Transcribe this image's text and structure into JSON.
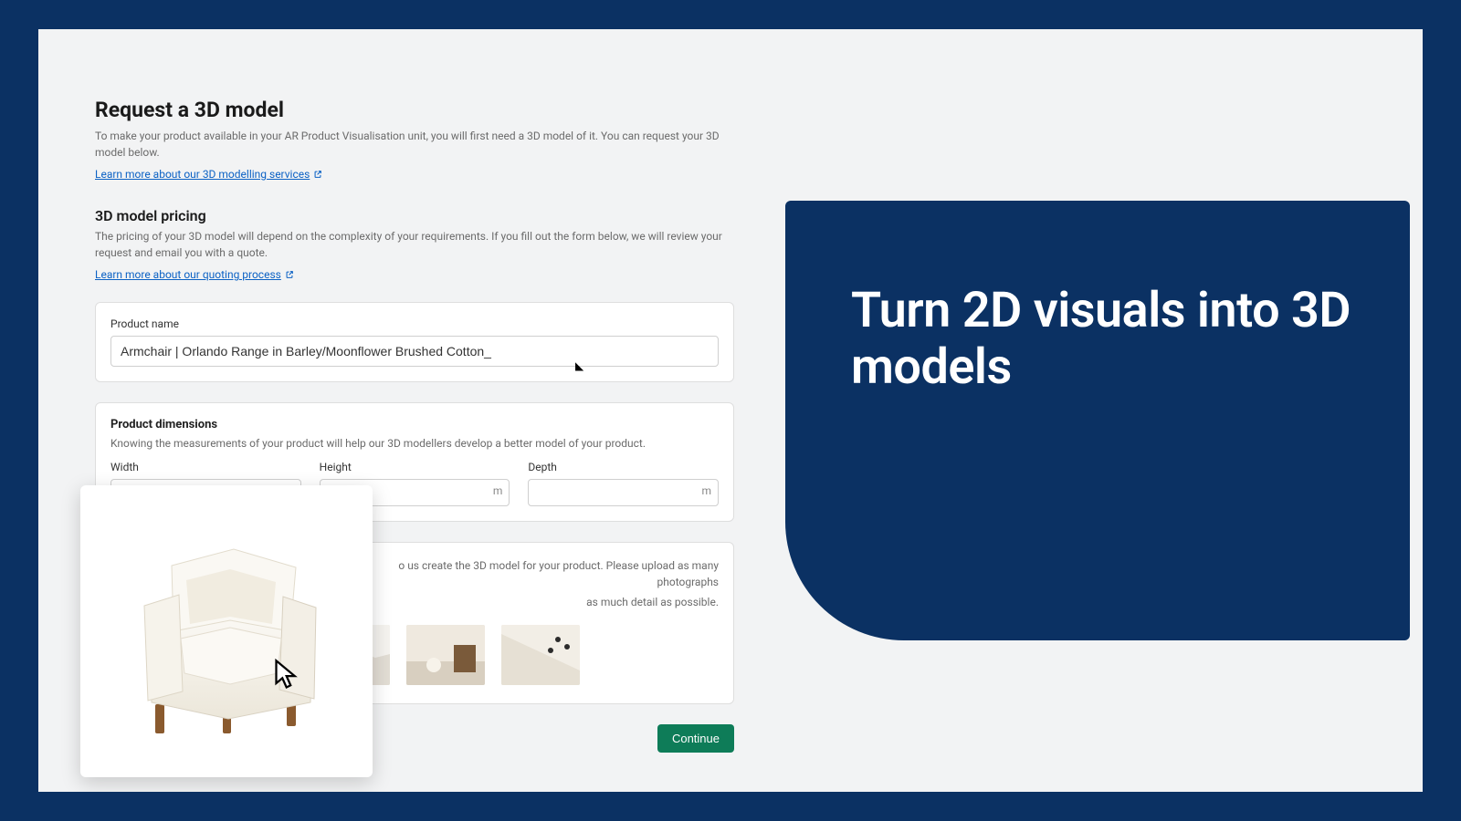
{
  "header": {
    "title": "Request a 3D model",
    "intro": "To make your product available in your AR Product Visualisation unit, you will first need a 3D model of it. You can request your 3D model below.",
    "link1": "Learn more about our 3D modelling services"
  },
  "pricing": {
    "heading": "3D model pricing",
    "text": "The pricing of your 3D model will depend on the complexity of your requirements. If you fill out the form below, we will review your request and email you with a quote.",
    "link": "Learn more about our quoting process"
  },
  "product_name": {
    "label": "Product name",
    "value": "Armchair | Orlando Range in Barley/Moonflower Brushed Cotton_"
  },
  "dimensions": {
    "heading": "Product dimensions",
    "sub": "Knowing the measurements of your product will help our 3D modellers develop a better model of your product.",
    "width_label": "Width",
    "height_label": "Height",
    "depth_label": "Depth",
    "unit": "m"
  },
  "photos": {
    "heading_fragment": "o us create the 3D model for your product. Please upload as many photographs",
    "sub_fragment": "as much detail as possible."
  },
  "continue_label": "Continue",
  "promo": {
    "title": "Turn 2D visuals into 3D models"
  },
  "colors": {
    "brand_navy": "#0b3163",
    "link_blue": "#0b61c4",
    "primary_green": "#0e7c58"
  }
}
